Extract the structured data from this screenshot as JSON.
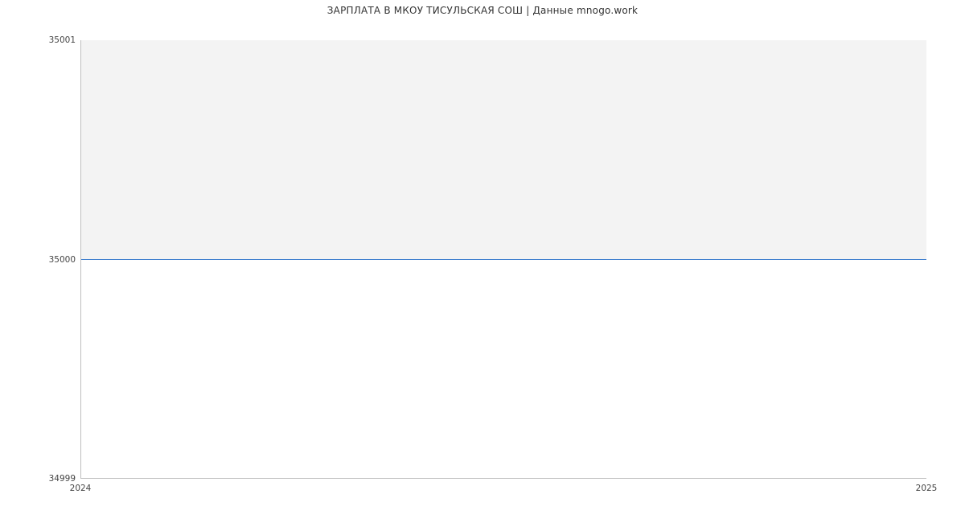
{
  "chart_data": {
    "type": "line",
    "title": "ЗАРПЛАТА В МКОУ ТИСУЛЬСКАЯ СОШ | Данные mnogo.work",
    "x": [
      2024,
      2025
    ],
    "series": [
      {
        "name": "salary",
        "values": [
          35000,
          35000
        ],
        "color": "#3f7fce"
      }
    ],
    "xlabel": "",
    "ylabel": "",
    "xlim": [
      2024,
      2025
    ],
    "ylim": [
      34999,
      35001
    ],
    "y_ticks": [
      34999,
      35000,
      35001
    ],
    "x_ticks": [
      2024,
      2025
    ],
    "grid": false
  },
  "ticks": {
    "y0": "34999",
    "y1": "35000",
    "y2": "35001",
    "x0": "2024",
    "x1": "2025"
  }
}
